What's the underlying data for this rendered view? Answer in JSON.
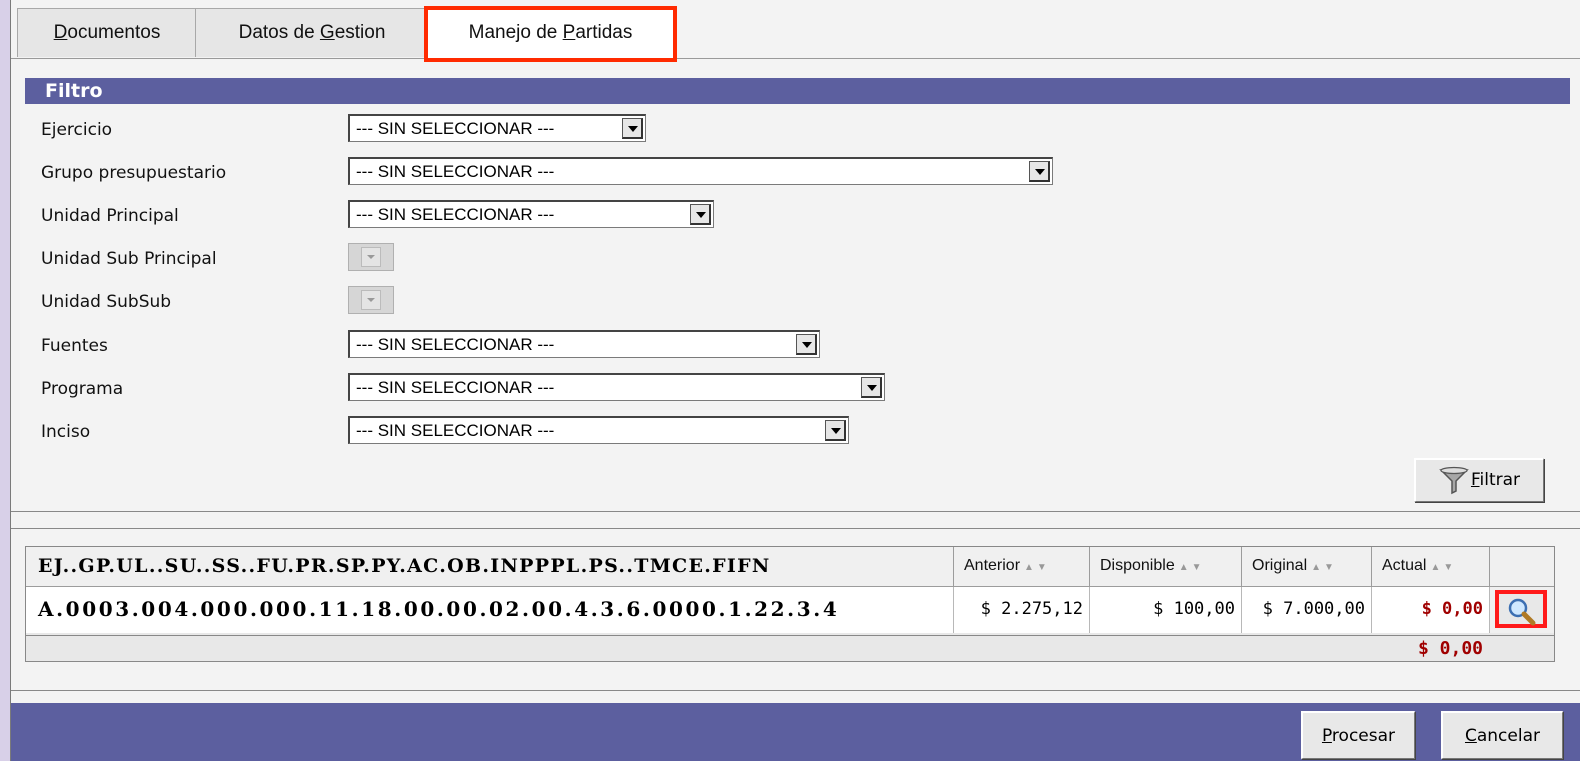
{
  "tabs": {
    "documentos": {
      "pre": "",
      "u": "D",
      "post": "ocumentos"
    },
    "datos": {
      "pre": "Datos de ",
      "u": "G",
      "post": "estion"
    },
    "manejo": {
      "pre": "Manejo de ",
      "u": "P",
      "post": "artidas"
    }
  },
  "filter": {
    "header": "Filtro",
    "rows": [
      {
        "label": "Ejercicio",
        "value": "--- SIN SELECCIONAR ---"
      },
      {
        "label": "Grupo presupuestario",
        "value": "--- SIN SELECCIONAR ---"
      },
      {
        "label": "Unidad Principal",
        "value": "--- SIN SELECCIONAR ---"
      },
      {
        "label": "Unidad Sub Principal",
        "value": ""
      },
      {
        "label": "Unidad SubSub",
        "value": ""
      },
      {
        "label": "Fuentes",
        "value": "--- SIN SELECCIONAR ---"
      },
      {
        "label": "Programa",
        "value": "--- SIN SELECCIONAR ---"
      },
      {
        "label": "Inciso",
        "value": "--- SIN SELECCIONAR ---"
      }
    ],
    "filtrar_u": "F",
    "filtrar_rest": "iltrar"
  },
  "grid": {
    "headers": {
      "code": "EJ..GP.UL..SU..SS..FU.PR.SP.PY.AC.OB.INPPPL.PS..TMCE.FIFN",
      "anterior": "Anterior",
      "disponible": "Disponible",
      "original": "Original",
      "actual": "Actual"
    },
    "row": {
      "code": "A.0003.004.000.000.11.18.00.00.02.00.4.3.6.0000.1.22.3.4",
      "anterior": "$ 2.275,12",
      "disponible": "$ 100,00",
      "original": "$ 7.000,00",
      "actual": "$ 0,00"
    },
    "total": "$ 0,00"
  },
  "footer": {
    "procesar_u": "P",
    "procesar_rest": "rocesar",
    "cancelar_u": "C",
    "cancelar_rest": "ancelar"
  }
}
